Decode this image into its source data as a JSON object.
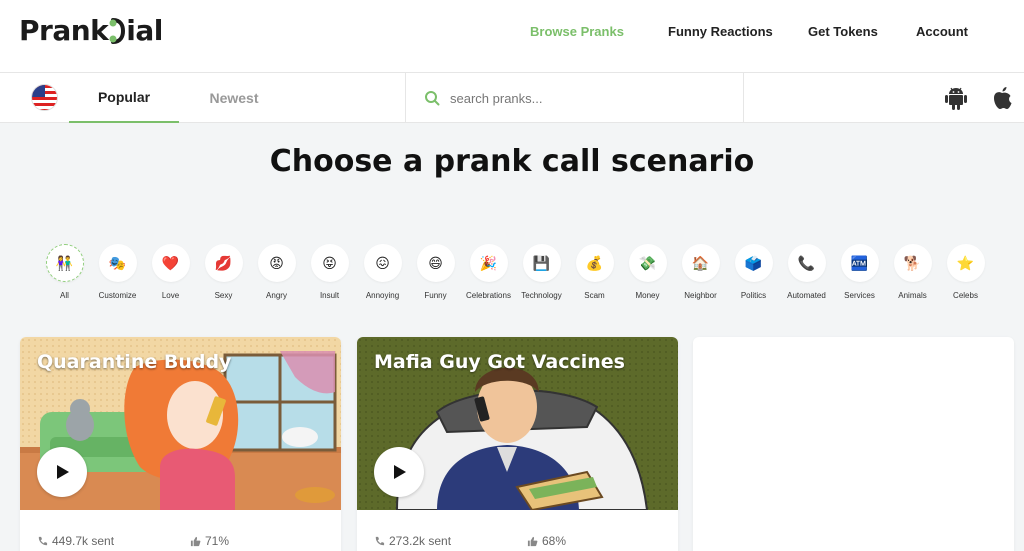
{
  "brand": {
    "logo_left": "Prank",
    "logo_right": "ial"
  },
  "nav": {
    "items": [
      {
        "label": "Browse Pranks",
        "active": true
      },
      {
        "label": "Funny Reactions",
        "active": false
      },
      {
        "label": "Get Tokens",
        "active": false
      },
      {
        "label": "Account",
        "active": false
      }
    ]
  },
  "tabs": {
    "items": [
      {
        "label": "Popular",
        "active": true
      },
      {
        "label": "Newest",
        "active": false
      }
    ]
  },
  "search": {
    "placeholder": "search pranks..."
  },
  "headline": "Choose a prank call scenario",
  "categories": [
    {
      "label": "All",
      "icon": "people-icon",
      "glyph": "👫",
      "active": true
    },
    {
      "label": "Customize",
      "icon": "customize-icon",
      "glyph": "🎭"
    },
    {
      "label": "Love",
      "icon": "heart-icon",
      "glyph": "❤️"
    },
    {
      "label": "Sexy",
      "icon": "lips-icon",
      "glyph": "💋"
    },
    {
      "label": "Angry",
      "icon": "angry-face-icon",
      "glyph": "😡"
    },
    {
      "label": "Insult",
      "icon": "insult-face-icon",
      "glyph": "😝"
    },
    {
      "label": "Annoying",
      "icon": "annoyed-face-icon",
      "glyph": "😖"
    },
    {
      "label": "Funny",
      "icon": "laughing-face-icon",
      "glyph": "😄"
    },
    {
      "label": "Celebrations",
      "icon": "party-popper-icon",
      "glyph": "🎉"
    },
    {
      "label": "Technology",
      "icon": "device-icon",
      "glyph": "💾"
    },
    {
      "label": "Scam",
      "icon": "money-bag-icon",
      "glyph": "💰"
    },
    {
      "label": "Money",
      "icon": "money-icon",
      "glyph": "💸"
    },
    {
      "label": "Neighbor",
      "icon": "house-icon",
      "glyph": "🏠"
    },
    {
      "label": "Politics",
      "icon": "politician-icon",
      "glyph": "🗳️"
    },
    {
      "label": "Automated",
      "icon": "phone-receiver-icon",
      "glyph": "📞"
    },
    {
      "label": "Services",
      "icon": "cash-register-icon",
      "glyph": "🏧"
    },
    {
      "label": "Animals",
      "icon": "dog-icon",
      "glyph": "🐕"
    },
    {
      "label": "Celebs",
      "icon": "star-icon",
      "glyph": "⭐"
    }
  ],
  "cards": [
    {
      "title": "Quarantine Buddy",
      "sent": "449.7k sent",
      "likes": "71%"
    },
    {
      "title": "Mafia Guy Got Vaccines",
      "sent": "273.2k sent",
      "likes": "68%"
    }
  ],
  "colors": {
    "accent": "#7bbf6a",
    "background": "#f3f5f6"
  }
}
